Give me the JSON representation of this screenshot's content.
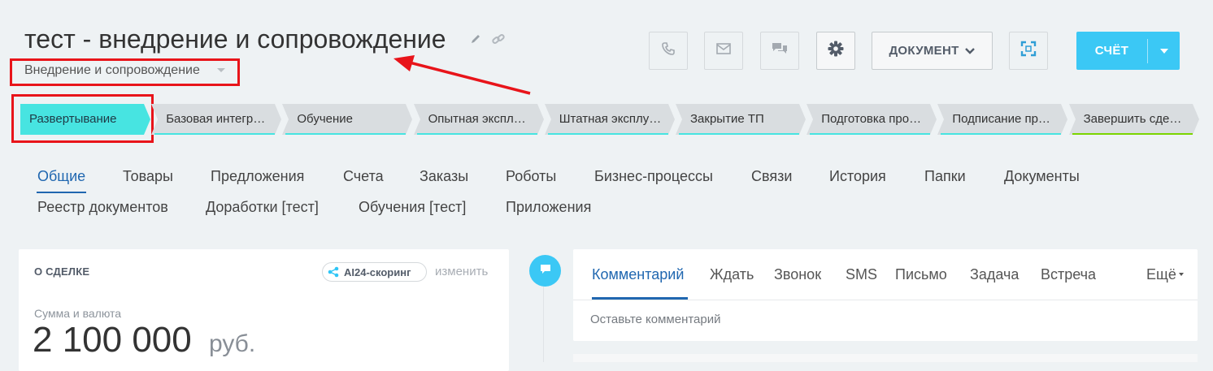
{
  "header": {
    "title": "тест - внедрение и сопровождение",
    "category": "Внедрение и сопровождение",
    "document_button": "ДОКУМЕНТ",
    "invoice_button": "СЧЁТ"
  },
  "stages": [
    {
      "label": "Развертывание",
      "color": "#47e4e1",
      "active": true
    },
    {
      "label": "Базовая интегр…",
      "color": "#47e4e1",
      "active": false
    },
    {
      "label": "Обучение",
      "color": "#47e4e1",
      "active": false
    },
    {
      "label": "Опытная экспл…",
      "color": "#47e4e1",
      "active": false
    },
    {
      "label": "Штатная эксплу…",
      "color": "#47e4e1",
      "active": false
    },
    {
      "label": "Закрытие ТП",
      "color": "#47e4e1",
      "active": false
    },
    {
      "label": "Подготовка про…",
      "color": "#47e4e1",
      "active": false
    },
    {
      "label": "Подписание пр…",
      "color": "#47e4e1",
      "active": false
    },
    {
      "label": "Завершить сде…",
      "color": "#7bd500",
      "active": false
    }
  ],
  "tabs": {
    "row1": [
      "Общие",
      "Товары",
      "Предложения",
      "Счета",
      "Заказы",
      "Роботы",
      "Бизнес-процессы",
      "Связи",
      "История",
      "Папки",
      "Документы"
    ],
    "row2": [
      "Реестр документов",
      "Доработки [тест]",
      "Обучения [тест]",
      "Приложения"
    ]
  },
  "about": {
    "section_title": "О СДЕЛКЕ",
    "ai_badge": "AI24-скоринг",
    "change_link": "изменить",
    "amount_label": "Сумма и валюта",
    "amount": "2 100 000",
    "currency": "руб."
  },
  "activity": {
    "tabs": [
      "Комментарий",
      "Ждать",
      "Звонок",
      "SMS",
      "Письмо",
      "Задача",
      "Встреча"
    ],
    "more": "Ещё",
    "comment_placeholder": "Оставьте комментарий"
  },
  "colors": {
    "accent": "#3bc8f5",
    "link": "#2067b0",
    "stage_active": "#47e4e1",
    "stage_final": "#7bd500",
    "annotation": "#e8141a"
  },
  "icons": [
    "pencil-icon",
    "link-icon",
    "phone-icon",
    "mail-icon",
    "chat-icon",
    "gear-icon",
    "chevron-down-icon",
    "sync-icon",
    "caret-down-icon",
    "ai-share-icon",
    "comment-icon"
  ]
}
